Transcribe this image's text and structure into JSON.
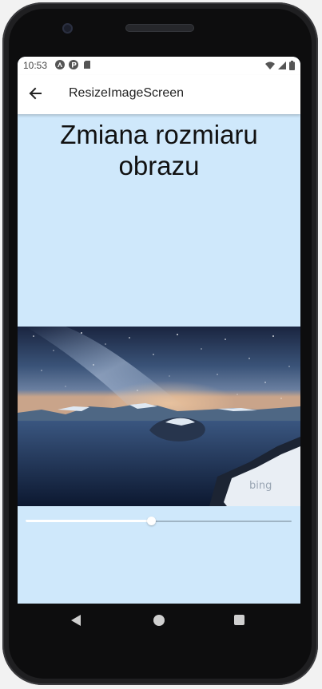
{
  "status_bar": {
    "time": "10:53",
    "left_icons": [
      "android-auto-icon",
      "app-notification-icon",
      "sd-card-icon"
    ],
    "right_icons": [
      "wifi-icon",
      "cell-signal-icon",
      "battery-icon"
    ]
  },
  "app_bar": {
    "back_icon": "arrow-left-icon",
    "title": "ResizeImageScreen"
  },
  "content": {
    "heading": "Zmiana rozmiaru obrazu",
    "image": {
      "description_icon": "landscape-photo",
      "watermark": "bing"
    },
    "slider": {
      "value": 0.47
    }
  },
  "nav_bar": {
    "icons": [
      "back-triangle-icon",
      "home-circle-icon",
      "recents-square-icon"
    ]
  },
  "colors": {
    "screen_background": "#cfe8fb",
    "app_bar_background": "#ffffff",
    "slider_active": "#ffffff",
    "slider_inactive": "#9fb4c4",
    "device_frame": "#1f1f21"
  }
}
